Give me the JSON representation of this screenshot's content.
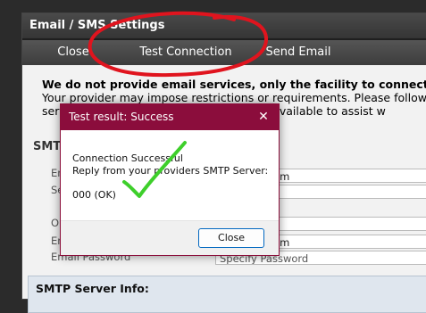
{
  "panel": {
    "title": "Email / SMS Settings"
  },
  "toolbar": {
    "close": "Close",
    "test": "Test Connection",
    "send": "Send Email"
  },
  "notice": {
    "line1": "We do not provide email services, only the facility to connect dire",
    "line2": "Your provider may impose restrictions or requirements. Please follow",
    "line3_left": "serv",
    "line3_right": "guides available to assist w"
  },
  "section": {
    "smtp_partial": "SMT"
  },
  "form": {
    "labels": [
      "Em",
      "Se",
      "Ou",
      "Em"
    ],
    "values": [
      "k@gmail.com",
      "",
      "com",
      "k@gmail.com"
    ],
    "password_label": "Email Password",
    "password_placeholder": "Specify Password"
  },
  "info": {
    "title": "SMTP Server Info:"
  },
  "dialog": {
    "title": "Test result: Success",
    "line1": "Connection Successful",
    "line2": "Reply from your providers SMTP Server:",
    "line3": "000 (OK)",
    "close": "Close"
  },
  "colors": {
    "dialog_accent": "#8b0d3c",
    "annotation_red": "#e0141e",
    "checkmark": "#3ecf2b"
  }
}
